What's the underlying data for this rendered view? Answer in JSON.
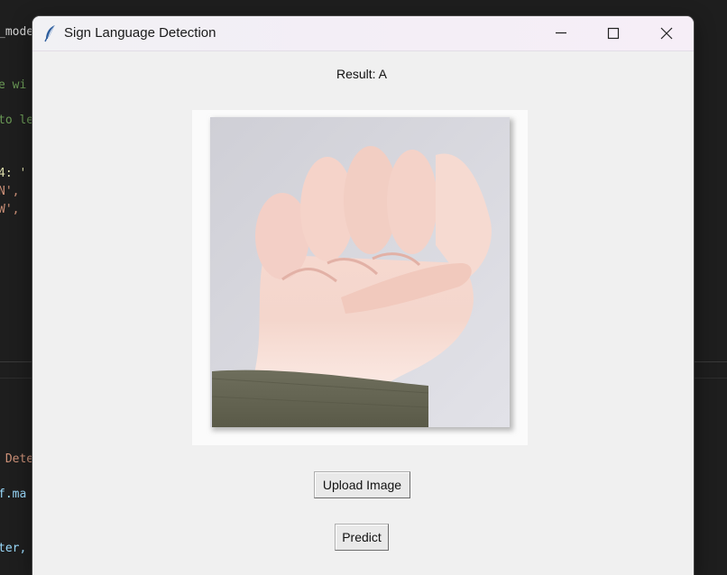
{
  "background_editor": {
    "lines": [
      {
        "text": "_mode",
        "color": "#d4d4d4"
      },
      {
        "text": "e wi",
        "color": "#6a9955"
      },
      {
        "text": "to le",
        "color": "#6a9955"
      },
      {
        "text": "4: '",
        "color": "#dcdcaa"
      },
      {
        "text": "N', ",
        "color": "#ce9178"
      },
      {
        "text": "W', ",
        "color": "#ce9178"
      },
      {
        "text": " Dete",
        "color": "#ce9178"
      },
      {
        "text": "f.ma",
        "color": "#9cdcfe"
      },
      {
        "text": "ter,",
        "color": "#9cdcfe"
      }
    ]
  },
  "window": {
    "title": "Sign Language Detection",
    "icons": {
      "app": "feather-icon",
      "minimize": "minimize-icon",
      "maximize": "maximize-icon",
      "close": "close-icon"
    }
  },
  "result": {
    "text": "Result: A"
  },
  "image": {
    "description_icon": "hand-fist-image"
  },
  "buttons": {
    "upload": "Upload Image",
    "predict": "Predict"
  },
  "colors": {
    "window_bg": "#f0f0f0",
    "editor_bg": "#1e1e1e"
  }
}
